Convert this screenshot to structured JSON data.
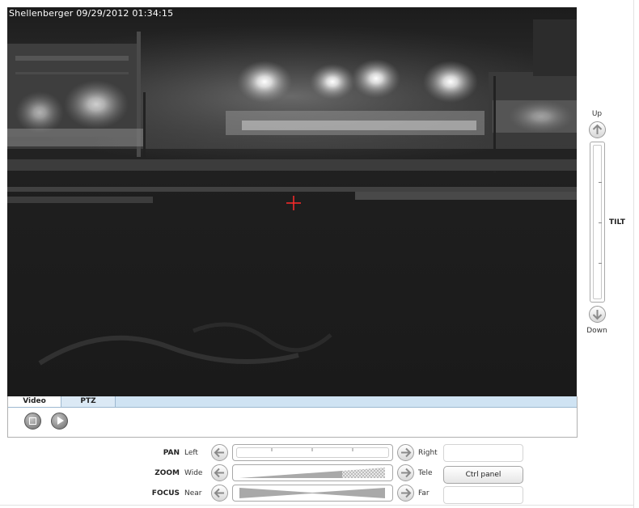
{
  "video": {
    "overlay_title": "Shellenberger 09/29/2012 01:34:15",
    "crosshair_color": "#ff2a2a"
  },
  "tabs": [
    {
      "label": "Video",
      "active": true
    },
    {
      "label": "PTZ",
      "active": false
    }
  ],
  "player": {
    "stop_icon": "stop-icon",
    "play_icon": "play-icon"
  },
  "tilt": {
    "up_label": "Up",
    "down_label": "Down",
    "label": "TILT"
  },
  "pan": {
    "name": "PAN",
    "left_label": "Left",
    "right_label": "Right"
  },
  "zoom": {
    "name": "ZOOM",
    "left_label": "Wide",
    "right_label": "Tele"
  },
  "focus": {
    "name": "FOCUS",
    "left_label": "Near",
    "right_label": "Far"
  },
  "ctrl_panel_label": "Ctrl panel",
  "colors": {
    "tab_strip": "#cfe3f3",
    "video_background": "#222222"
  }
}
